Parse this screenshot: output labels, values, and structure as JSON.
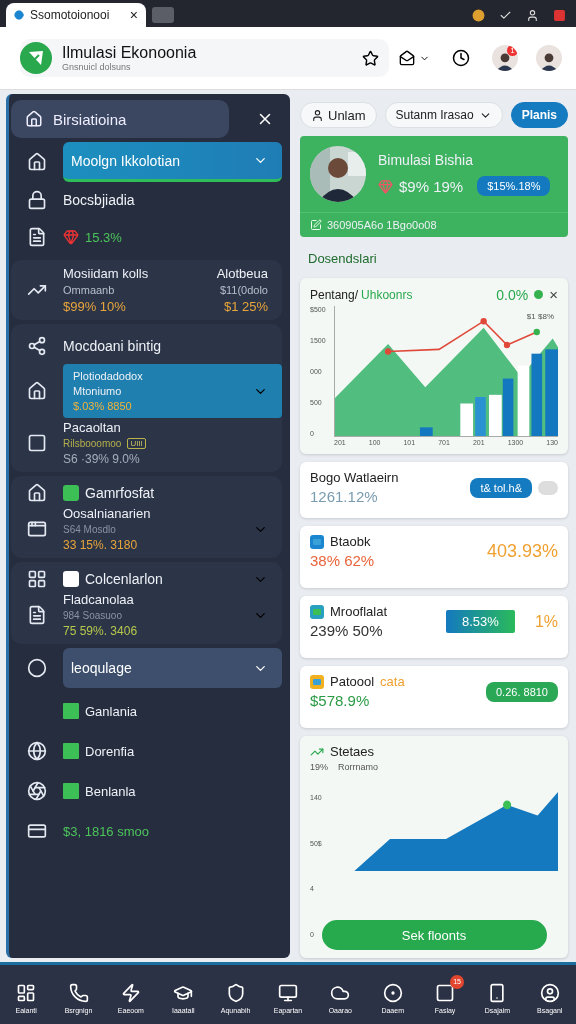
{
  "browser": {
    "tab_title": "Ssomotoionooi",
    "tab_close": "×"
  },
  "header": {
    "title": "Ilmulasi Ekonoonia",
    "subtitle": "Gnsnuicl dolsuns",
    "notification_count": "1"
  },
  "sidebar": {
    "title": "Birsiatioina",
    "groups": [
      {
        "kind": "plain",
        "items": [
          {
            "kind": "nav",
            "label": "Moolgn Ikkolotian",
            "selected": true,
            "expanded": false
          },
          {
            "kind": "title",
            "label": "Bocsbjiadia"
          },
          {
            "kind": "stat",
            "value": "15.3%"
          }
        ]
      },
      {
        "kind": "card",
        "items": [
          {
            "kind": "pair",
            "left": [
              "Mosiidam kolls",
              "Ommaanb",
              "$99% 10%"
            ],
            "right": [
              "Alotbeua",
              "$11(0dolo",
              "$1 25%"
            ]
          }
        ]
      },
      {
        "kind": "card",
        "items": [
          {
            "kind": "title",
            "label": "Mocdoani bintig"
          },
          {
            "kind": "sub",
            "lines": [
              "Plotiodadodox",
              "Mtoniumo",
              "$.03% 8850"
            ],
            "expanded": false
          },
          {
            "kind": "detail",
            "title": "Pacaoltan",
            "sub": "Rilsbooomoo",
            "tag": "UIII",
            "value": "S6 ·39% 9.0%"
          }
        ]
      },
      {
        "kind": "card",
        "items": [
          {
            "kind": "badge",
            "label": "Gamrfosfat",
            "color": "#3cbf55"
          },
          {
            "kind": "detail",
            "title": "Oosalnianarien",
            "sub": "S64 Mosdlo",
            "value": "33 15%. 3180",
            "expanded": false
          }
        ]
      },
      {
        "kind": "card",
        "items": [
          {
            "kind": "badge",
            "label": "Colcenlarlon",
            "color": "#ffffff",
            "expanded": false
          },
          {
            "kind": "detail",
            "title": "Fladcanolaa",
            "sub": "984 Soasuoo",
            "value": "75 59%. 3406",
            "expanded": false
          }
        ]
      },
      {
        "kind": "plain",
        "items": [
          {
            "kind": "group",
            "label": "leoqulage",
            "selected": true,
            "expanded": false
          }
        ]
      },
      {
        "kind": "plain",
        "items": [
          {
            "kind": "square",
            "label": "Ganlania"
          },
          {
            "kind": "square",
            "label": "Dorenfia"
          },
          {
            "kind": "square",
            "label": "Benlanla"
          },
          {
            "kind": "stat",
            "value": "$3, 1816 smoo"
          }
        ]
      }
    ]
  },
  "toolbar": {
    "user_button": "Unlam",
    "select": {
      "value": "Sutanm Irasao"
    },
    "primary_button": "Planis"
  },
  "profile": {
    "name": "Bimulasi Bishia",
    "stat": "$9% 19%",
    "pill": "$15%.18%",
    "footer": "360905A6o 1Bgo0o08"
  },
  "section_heading": "Dosendslari",
  "chart_card": {
    "title": "Pentang/",
    "title_accent": "Uhkoonrs",
    "change": "0.0%",
    "close": "×",
    "y_labels": [
      "$500",
      "1500",
      "000",
      "500",
      "0"
    ],
    "x_labels": [
      "201",
      "100",
      "101",
      "701",
      "201",
      "1300",
      "130"
    ],
    "annotation": "$1 $8%"
  },
  "cards": [
    {
      "kind": "toggle",
      "title": "Bogo Watlaeirn",
      "value": "1261.12%",
      "pill": "t& tol.h&",
      "on": false
    },
    {
      "kind": "figure",
      "title": "Btaobk",
      "value": "38% 62%",
      "figure": "403.93%"
    },
    {
      "kind": "meter",
      "title": "Mrooflalat",
      "value": "239% 50%",
      "pill": "8.53%",
      "figure": "1%"
    },
    {
      "kind": "tag",
      "title": "Patoool",
      "title_accent": "cata",
      "value": "$578.9%",
      "pill": "0.26. 8810"
    }
  ],
  "trend_card": {
    "title": "Stetaes",
    "subtitle_a": "19%",
    "subtitle_b": "Rorrnamo",
    "axis_labels": [
      "140",
      "50$",
      "4",
      "0"
    ],
    "button": "Sek floonts"
  },
  "bottom_nav": [
    {
      "label": "Eaianti"
    },
    {
      "label": "Bsrgnign"
    },
    {
      "label": "Eaeoom"
    },
    {
      "label": "Iaaatall"
    },
    {
      "label": "Aqunabih"
    },
    {
      "label": "Eapartan"
    },
    {
      "label": "Oaarao"
    },
    {
      "label": "Daaem"
    },
    {
      "label": "Faslay",
      "badge": "15"
    },
    {
      "label": "Dsajaim"
    },
    {
      "label": "Bsaganl"
    }
  ]
}
